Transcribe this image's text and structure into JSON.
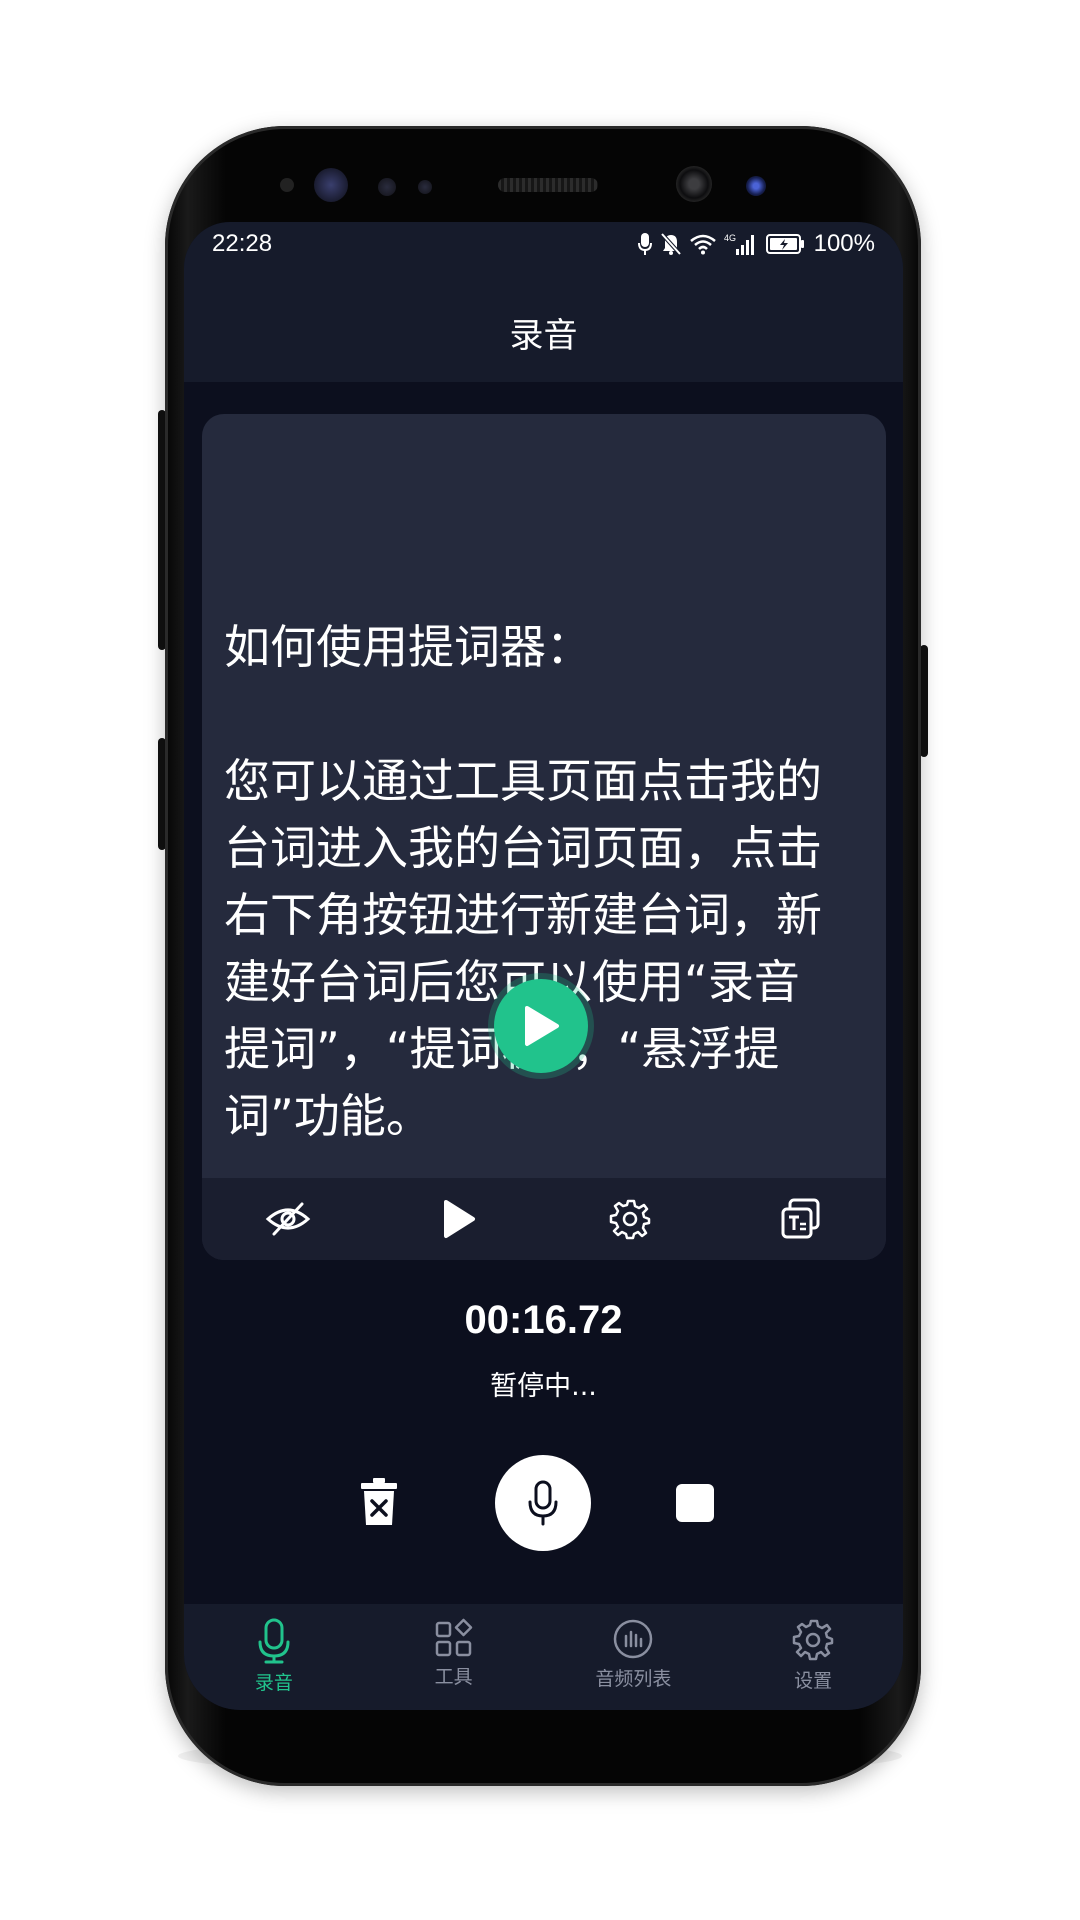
{
  "status_bar": {
    "time": "22:28",
    "battery": "100%",
    "network": "4G"
  },
  "app_bar": {
    "title": "录音"
  },
  "prompter": {
    "text": "如何使用提词器：\n\n您可以通过工具页面点击我的台词进入我的台词页面，点击右下角按钮进行新建台词，新建好台词后您可以使用“录音提词”，“提词板”，“悬浮提词”功能。"
  },
  "recording": {
    "timer": "00:16.72",
    "status": "暂停中..."
  },
  "bottom_nav": {
    "items": [
      {
        "label": "录音",
        "icon": "mic-icon",
        "active": true
      },
      {
        "label": "工具",
        "icon": "apps-icon",
        "active": false
      },
      {
        "label": "音频列表",
        "icon": "audio-list-icon",
        "active": false
      },
      {
        "label": "设置",
        "icon": "gear-icon",
        "active": false
      }
    ]
  },
  "colors": {
    "accent": "#21c38c",
    "background": "#0c0f1e",
    "surface": "#161b2b",
    "card": "#252a3d",
    "inactive": "#8a8fa0"
  }
}
